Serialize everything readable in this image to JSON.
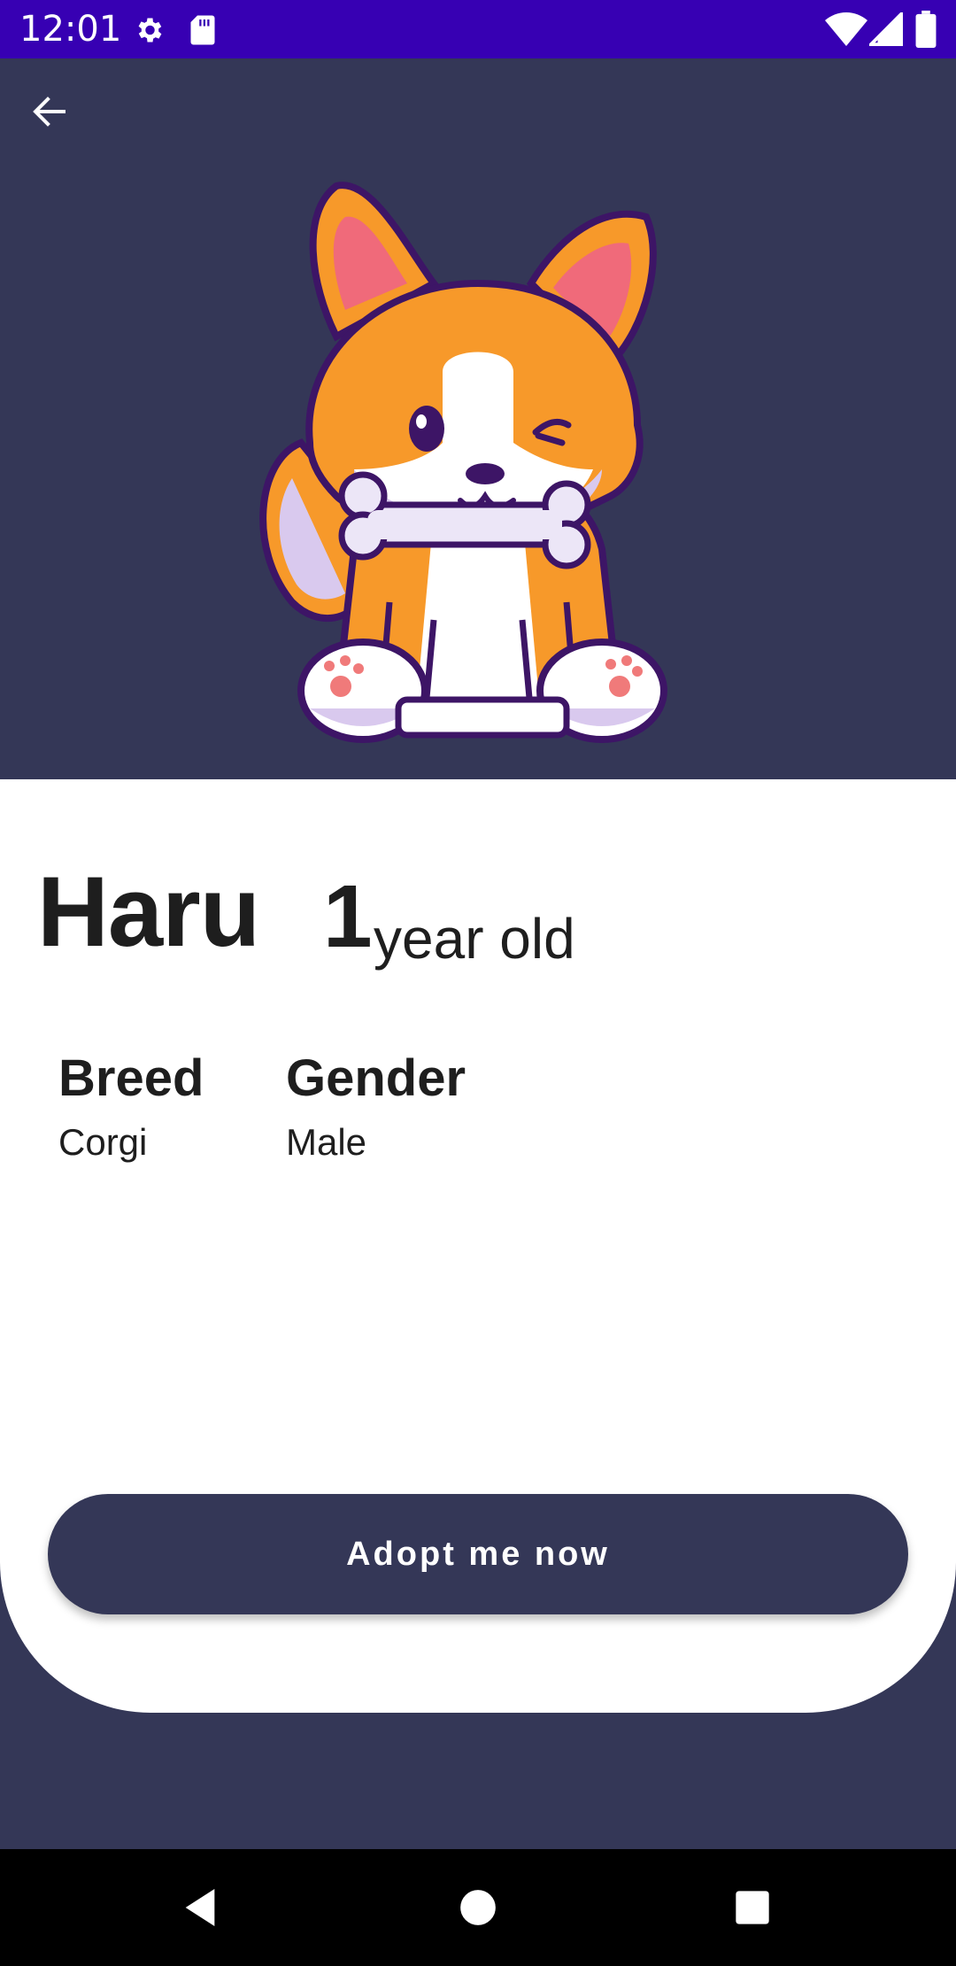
{
  "status_bar": {
    "time": "12:01",
    "icons": [
      "gear-icon",
      "sd-card-icon",
      "wifi-icon",
      "signal-icon",
      "battery-icon"
    ]
  },
  "header": {
    "back_icon": "arrow-left-icon",
    "hero_image": "corgi-illustration"
  },
  "pet": {
    "name": "Haru",
    "age_number": "1",
    "age_unit": "year old",
    "breed_label": "Breed",
    "breed_value": "Corgi",
    "gender_label": "Gender",
    "gender_value": "Male"
  },
  "actions": {
    "adopt_label": "Adopt me now"
  },
  "nav": {
    "back_icon": "triangle-back-icon",
    "home_icon": "circle-home-icon",
    "recents_icon": "square-recents-icon"
  },
  "colors": {
    "status_bar": "#3700b3",
    "primary": "#343757",
    "card": "#ffffff",
    "text": "#1e1e1e",
    "corgi_orange": "#f7992a"
  }
}
